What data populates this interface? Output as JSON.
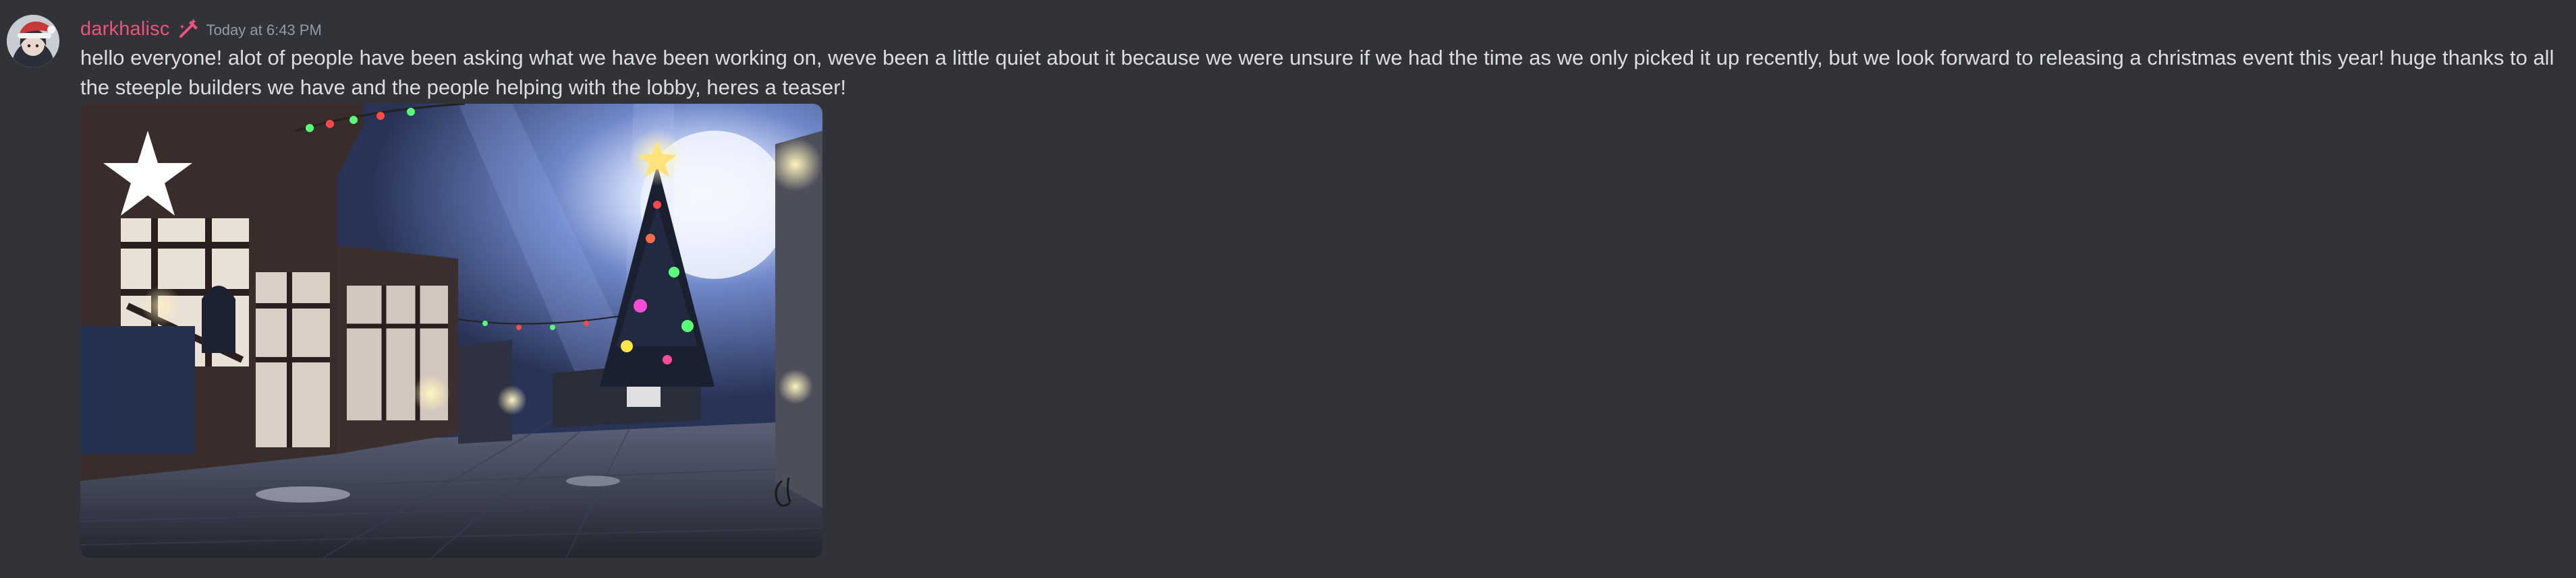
{
  "message": {
    "author": "darkhalisc",
    "timestamp": "Today at 6:43 PM",
    "content": "hello everyone! alot of people have been asking what we have been working on, weve been a little quiet about it because we were unsure if we had the time as we only picked it up recently, but we look forward to releasing a christmas event this year! huge thanks to all the steeple builders we have and the people helping with the lobby, heres a teaser!",
    "author_color": "#f0537a",
    "role_icon": "hammer-sparkle-icon",
    "avatar_icon": "avatar-santa-hat-icon",
    "attachment": {
      "kind": "image",
      "icon": "star-icon",
      "scene": "christmas-town-tree"
    }
  }
}
